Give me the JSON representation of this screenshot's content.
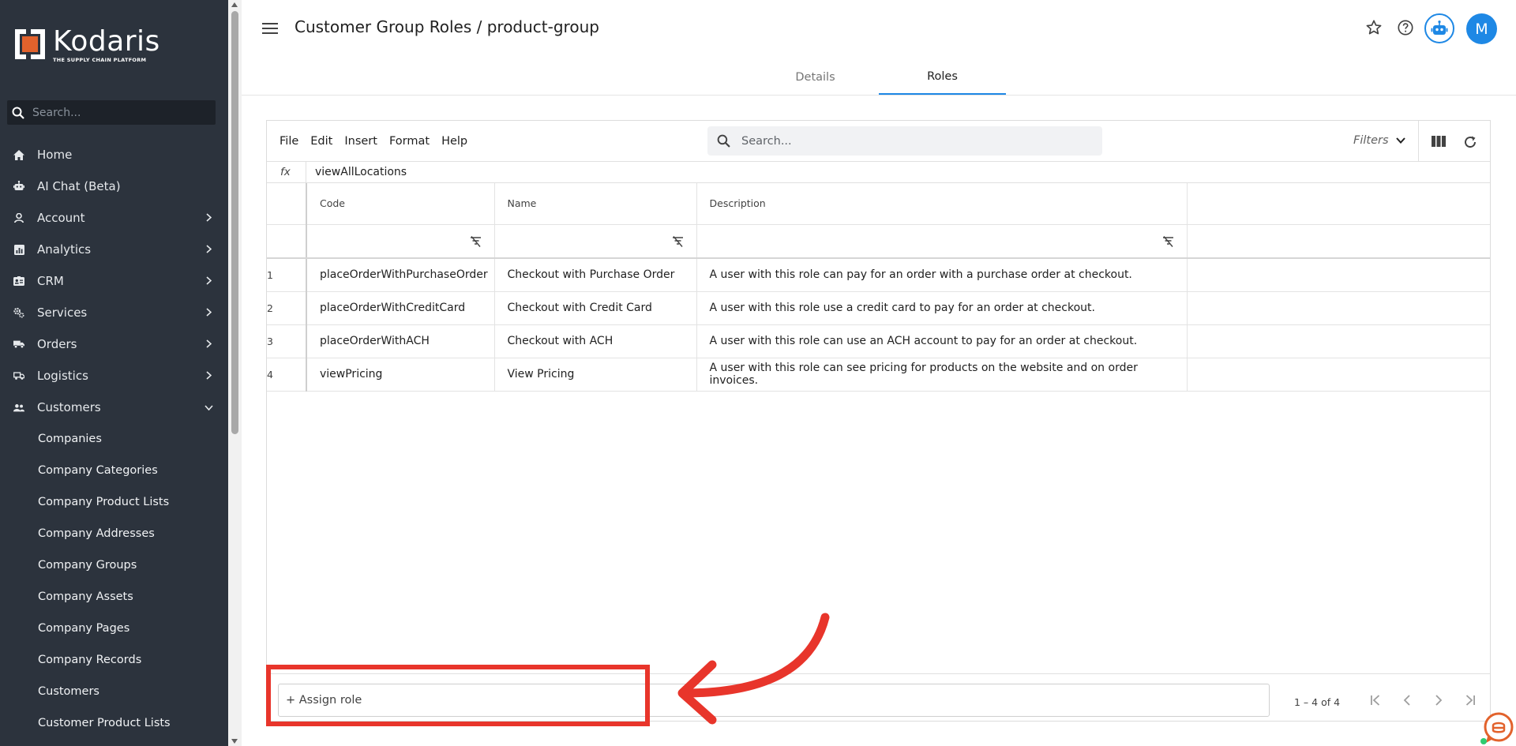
{
  "app": {
    "brand_name": "Kodaris",
    "brand_tagline": "THE SUPPLY CHAIN PLATFORM",
    "colors": {
      "sidebar_bg": "#2c333d",
      "accent": "#1e88e5",
      "annotation": "#e8352b",
      "logo_orange": "#e2622c"
    }
  },
  "sidebar": {
    "search_placeholder": "Search...",
    "items": [
      {
        "label": "Home",
        "icon": "home-icon",
        "has_chevron": false
      },
      {
        "label": "AI Chat (Beta)",
        "icon": "robot-icon",
        "has_chevron": false
      },
      {
        "label": "Account",
        "icon": "person-icon",
        "has_chevron": true
      },
      {
        "label": "Analytics",
        "icon": "analytics-icon",
        "has_chevron": true
      },
      {
        "label": "CRM",
        "icon": "id-card-icon",
        "has_chevron": true
      },
      {
        "label": "Services",
        "icon": "cogs-icon",
        "has_chevron": true
      },
      {
        "label": "Orders",
        "icon": "truck-icon",
        "has_chevron": true
      },
      {
        "label": "Logistics",
        "icon": "shipping-icon",
        "has_chevron": true
      },
      {
        "label": "Customers",
        "icon": "people-icon",
        "has_chevron": true,
        "expanded": true
      }
    ],
    "sub_items": [
      "Companies",
      "Company Categories",
      "Company Product Lists",
      "Company Addresses",
      "Company Groups",
      "Company Assets",
      "Company Pages",
      "Company Records",
      "Customers",
      "Customer Product Lists"
    ]
  },
  "header": {
    "title": "Customer Group Roles / product-group",
    "avatar_initial": "M",
    "tabs": [
      {
        "label": "Details",
        "active": false
      },
      {
        "label": "Roles",
        "active": true
      }
    ]
  },
  "toolbar": {
    "menu": [
      "File",
      "Edit",
      "Insert",
      "Format",
      "Help"
    ],
    "search_placeholder": "Search...",
    "filters_label": "Filters"
  },
  "formula_bar": {
    "fx_label": "fx",
    "value": "viewAllLocations"
  },
  "grid": {
    "columns": [
      "Code",
      "Name",
      "Description"
    ],
    "rows": [
      {
        "num": "1",
        "code": "placeOrderWithPurchaseOrder",
        "name": "Checkout with Purchase Order",
        "description": "A user with this role can pay for an order with a purchase order at checkout."
      },
      {
        "num": "2",
        "code": "placeOrderWithCreditCard",
        "name": "Checkout with Credit Card",
        "description": "A user with this role use a credit card to pay for an order at checkout."
      },
      {
        "num": "3",
        "code": "placeOrderWithACH",
        "name": "Checkout with ACH",
        "description": "A user with this role can use an ACH account to pay for an order at checkout."
      },
      {
        "num": "4",
        "code": "viewPricing",
        "name": "View Pricing",
        "description": "A user with this role can see pricing for products on the website and on order invoices."
      }
    ]
  },
  "footer": {
    "assign_label": "+ Assign role",
    "pager_text": "1 – 4 of 4"
  }
}
